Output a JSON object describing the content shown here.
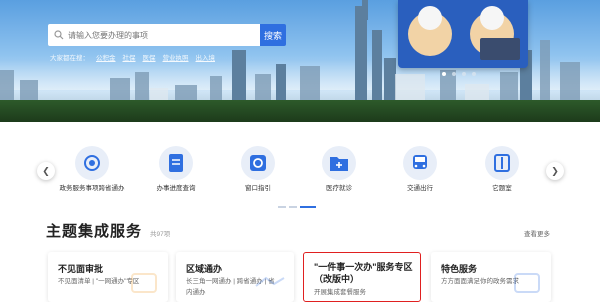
{
  "hero": {
    "logo_text": "",
    "search_placeholder": "请输入您要办理的事项",
    "search_button": "搜索",
    "hot_words": [
      "大家都在搜：",
      "公积金",
      "社保",
      "医保",
      "营业执照",
      "出入境"
    ],
    "colors": {
      "accent": "#2f6fe0",
      "panel": "#2a5fbe"
    }
  },
  "quick_services": [
    {
      "label": "政务服务事项跨省通办",
      "icon": "gear-icon"
    },
    {
      "label": "办事进度查询",
      "icon": "document-list-icon"
    },
    {
      "label": "窗口指引",
      "icon": "window-guide-icon"
    },
    {
      "label": "医疗就诊",
      "icon": "folder-plus-icon"
    },
    {
      "label": "交通出行",
      "icon": "bus-icon"
    },
    {
      "label": "它题室",
      "icon": "gate-icon"
    }
  ],
  "theme_section": {
    "title": "主题集成服务",
    "count": "共97项",
    "more": "查看更多",
    "cards": [
      {
        "title": "不见面审批",
        "subtitle": "不见面清单  |  \"一网通办\"专区"
      },
      {
        "title": "区域通办",
        "subtitle": "长三角一网通办  |  跨省通办  |  省内通办"
      },
      {
        "title": "\"一件事一次办\"服务专区（改版中）",
        "subtitle": "开展集成套餐服务"
      },
      {
        "title": "特色服务",
        "subtitle": "方方面面满足你的政务需求"
      }
    ]
  }
}
